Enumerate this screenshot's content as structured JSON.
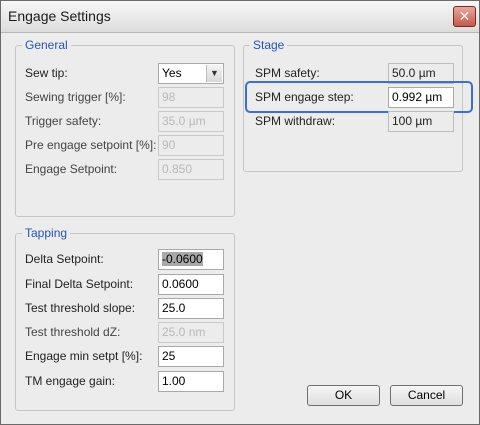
{
  "window": {
    "title": "Engage Settings",
    "close_glyph": "✕"
  },
  "general": {
    "title": "General",
    "sew_tip": {
      "label": "Sew tip:",
      "value": "Yes"
    },
    "sewing_trigger": {
      "label": "Sewing trigger [%]:",
      "value": "98"
    },
    "trigger_safety": {
      "label": "Trigger safety:",
      "value": "35.0 µm"
    },
    "pre_engage_setpoint": {
      "label": "Pre engage setpoint [%]:",
      "value": "90"
    },
    "engage_setpoint": {
      "label": "Engage Setpoint:",
      "value": "0.850"
    }
  },
  "stage": {
    "title": "Stage",
    "spm_safety": {
      "label": "SPM safety:",
      "value": "50.0 µm"
    },
    "spm_engage_step": {
      "label": "SPM engage step:",
      "value": "0.992 µm"
    },
    "spm_withdraw": {
      "label": "SPM withdraw:",
      "value": "100 µm"
    }
  },
  "tapping": {
    "title": "Tapping",
    "delta_setpoint": {
      "label": "Delta Setpoint:",
      "value": "-0.0600"
    },
    "final_delta_setpoint": {
      "label": "Final Delta Setpoint:",
      "value": "0.0600"
    },
    "test_threshold_slope": {
      "label": "Test threshold slope:",
      "value": "25.0"
    },
    "test_threshold_dz": {
      "label": "Test threshold dZ:",
      "value": "25.0 nm"
    },
    "engage_min_setpt": {
      "label": "Engage min setpt [%]:",
      "value": "25"
    },
    "tm_engage_gain": {
      "label": "TM engage gain:",
      "value": "1.00"
    }
  },
  "buttons": {
    "ok": "OK",
    "cancel": "Cancel"
  },
  "colors": {
    "group_title": "#2456b8",
    "highlight": "#3a6fd8",
    "close_button": "#c8584a"
  }
}
